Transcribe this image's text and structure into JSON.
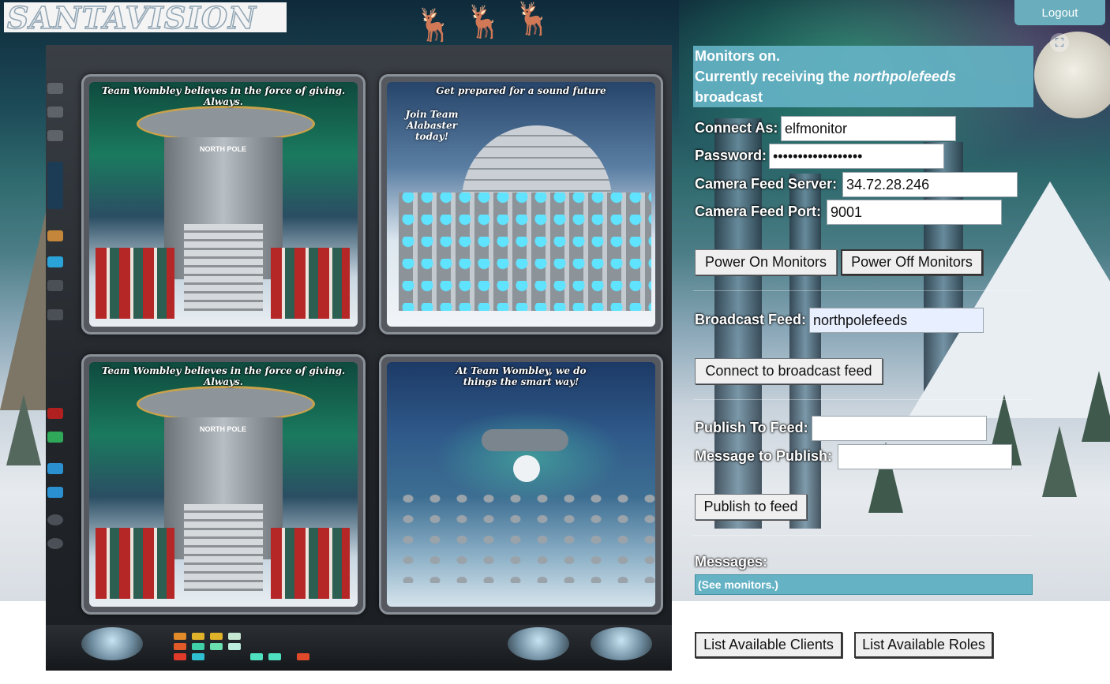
{
  "logo": {
    "text": "SANTAVISION"
  },
  "header": {
    "logout_label": "Logout",
    "fullscreen_icon": "fullscreen-icon"
  },
  "monitors": {
    "screen1": {
      "caption": "Team Wombley believes in the force of giving. Always.",
      "sign": "NORTH POLE"
    },
    "screen2": {
      "caption": "Get prepared for a sound future",
      "side_caption": "Join Team Alabaster today!"
    },
    "screen3": {
      "caption": "Team Wombley believes in the force of giving. Always.",
      "sign": "NORTH POLE"
    },
    "screen4": {
      "caption": "At Team Wombley, we do things the smart way!"
    }
  },
  "status": {
    "line1": "Monitors on.",
    "line2_prefix": "Currently receiving the ",
    "line2_feed": "northpolefeeds",
    "line3": "broadcast"
  },
  "connect": {
    "connect_as_label": "Connect As:",
    "connect_as_value": "elfmonitor",
    "password_label": "Password:",
    "password_value": "••••••••••••••••••",
    "server_label": "Camera Feed Server:",
    "server_value": "34.72.28.246",
    "port_label": "Camera Feed Port:",
    "port_value": "9001",
    "power_on_label": "Power On Monitors",
    "power_off_label": "Power Off Monitors"
  },
  "broadcast": {
    "label": "Broadcast Feed:",
    "value": "northpolefeeds",
    "connect_label": "Connect to broadcast feed"
  },
  "publish": {
    "feed_label": "Publish To Feed:",
    "feed_value": "",
    "message_label": "Message to Publish:",
    "message_value": "",
    "publish_label": "Publish to feed"
  },
  "messages": {
    "label": "Messages:",
    "content": "(See monitors.)"
  },
  "footer": {
    "list_clients_label": "List Available Clients",
    "list_roles_label": "List Available Roles"
  },
  "colors": {
    "accent": "#64b2c4",
    "status_bg": "#64b2c4"
  }
}
